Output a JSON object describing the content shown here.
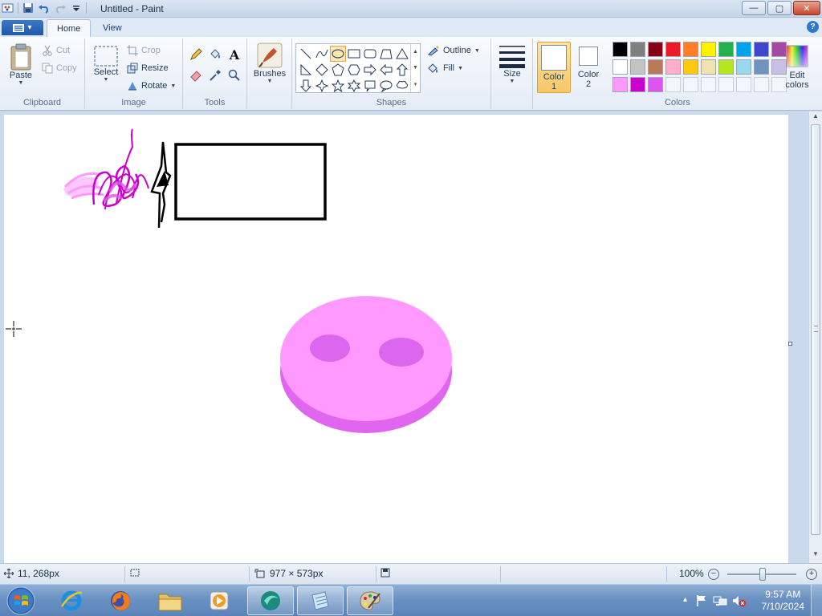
{
  "titlebar": {
    "title": "Untitled - Paint",
    "min_label": "—",
    "max_label": "▢",
    "close_label": "✕"
  },
  "tabs": {
    "app_menu": "▾",
    "home": "Home",
    "view": "View",
    "help": "?"
  },
  "clipboard": {
    "paste": "Paste",
    "cut": "Cut",
    "copy": "Copy",
    "group": "Clipboard"
  },
  "image": {
    "select": "Select",
    "crop": "Crop",
    "resize": "Resize",
    "rotate": "Rotate",
    "group": "Image"
  },
  "tools": {
    "group": "Tools",
    "text_glyph": "A"
  },
  "brushes": {
    "label": "Brushes"
  },
  "shapes": {
    "outline": "Outline",
    "fill": "Fill",
    "group": "Shapes"
  },
  "size": {
    "label": "Size"
  },
  "colors": {
    "color1_line1": "Color",
    "color1_line2": "1",
    "color2_line1": "Color",
    "color2_line2": "2",
    "edit_line1": "Edit",
    "edit_line2": "colors",
    "group": "Colors",
    "color1_value": "#ffffff",
    "color2_value": "#ffffff",
    "palette": [
      "#000000",
      "#7f7f7f",
      "#880015",
      "#ed1c24",
      "#ff7f27",
      "#fff200",
      "#22b14c",
      "#00a2e8",
      "#3f48cc",
      "#a349a4",
      "#ffffff",
      "#c3c3c3",
      "#b97a57",
      "#ffaec9",
      "#ffc90e",
      "#efe4b0",
      "#b5e61d",
      "#99d9ea",
      "#7092be",
      "#c8bfe7",
      "#ff99ff",
      "#cc00cc",
      "#dd55ee",
      "",
      "",
      "",
      "",
      "",
      "",
      ""
    ]
  },
  "drawing": {
    "pink_blob_color": "#ff99ff",
    "pink_blob_edge": "#e066f0",
    "pink_blob_eyes": "#dd66ee",
    "rectangle_color": "#000000",
    "scribble_magenta": "#cc00cc",
    "scribble_pink": "#ff99ff"
  },
  "status": {
    "cursor_position": "11, 268px",
    "selection_size": "",
    "canvas_size": "977 × 573px",
    "zoom": "100%",
    "zoom_out": "−",
    "zoom_in": "+"
  },
  "taskbar": {
    "time": "9:57 AM",
    "date": "7/10/2024"
  }
}
